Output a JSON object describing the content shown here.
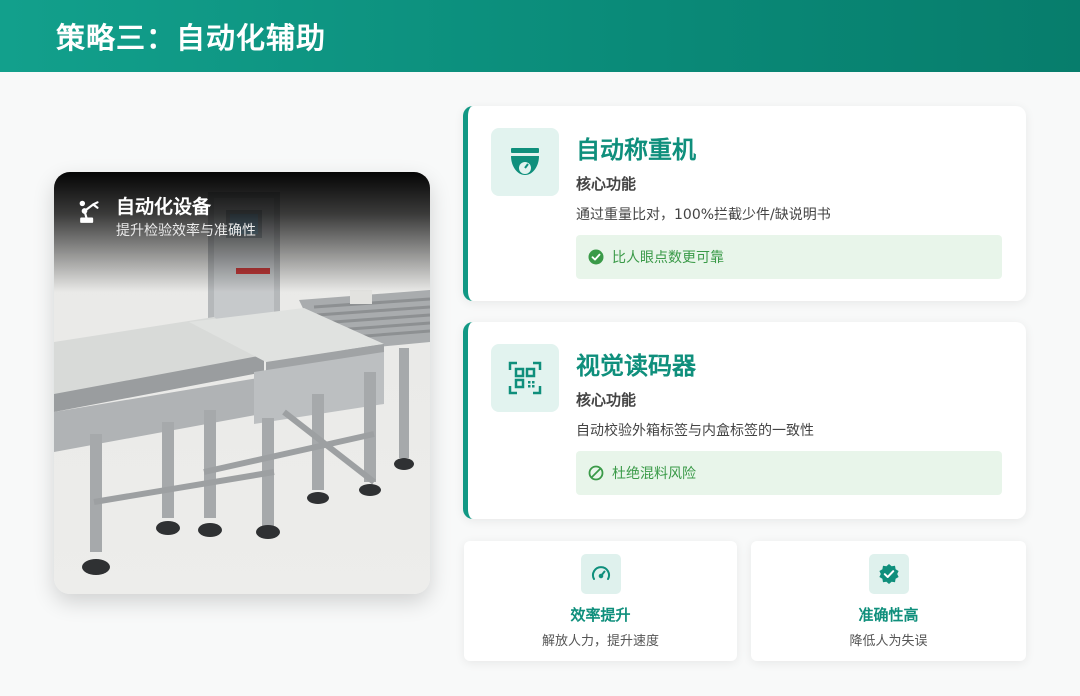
{
  "header": {
    "title": "策略三：自动化辅助"
  },
  "photo": {
    "title": "自动化设备",
    "subtitle": "提升检验效率与准确性",
    "icon": "robot-arm-icon"
  },
  "features": [
    {
      "title": "自动称重机",
      "subtitle": "核心功能",
      "description": "通过重量比对，100%拦截少件/缺说明书",
      "badge": "比人眼点数更可靠",
      "icon": "scale-icon",
      "badge_icon": "check-circle-icon"
    },
    {
      "title": "视觉读码器",
      "subtitle": "核心功能",
      "description": "自动校验外箱标签与内盒标签的一致性",
      "badge": "杜绝混料风险",
      "icon": "qr-scan-icon",
      "badge_icon": "ban-icon"
    }
  ],
  "stats": [
    {
      "title": "效率提升",
      "description": "解放人力，提升速度",
      "icon": "speedometer-icon"
    },
    {
      "title": "准确性高",
      "description": "降低人为失误",
      "icon": "verified-badge-icon"
    }
  ],
  "colors": {
    "accent": "#0f8f7c",
    "header_start": "#12a08c",
    "header_end": "#077d6c",
    "badge_bg": "#e8f5ea",
    "badge_text": "#3a9a48"
  }
}
